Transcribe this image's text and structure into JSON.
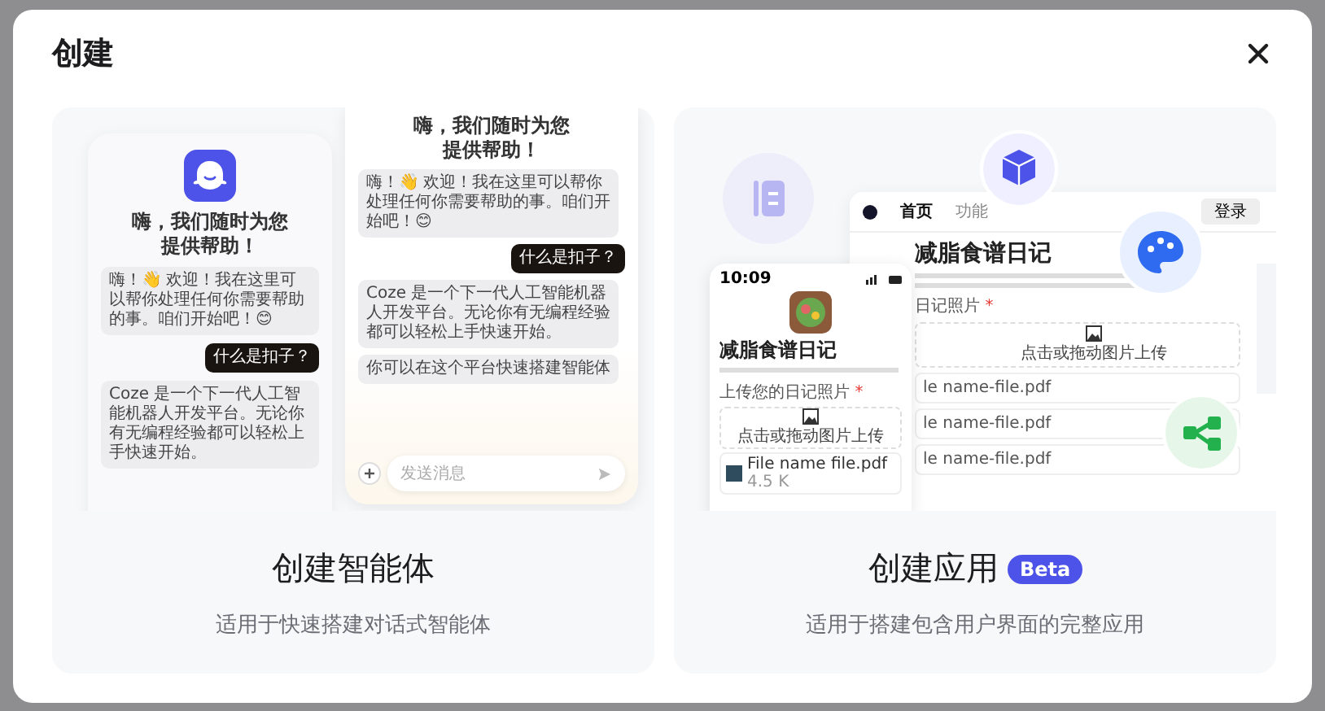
{
  "dialog": {
    "title": "创建"
  },
  "cards": [
    {
      "kind": "agent",
      "title": "创建智能体",
      "subtitle": "适用于快速搭建对话式智能体",
      "preview": {
        "left_phone": {
          "heading": "嗨，我们随时为您提供帮助！",
          "messages": [
            {
              "kind": "bot",
              "text": "嗨！👋 欢迎！我在这里可以帮你处理任何你需要帮助的事。咱们开始吧！😊"
            },
            {
              "kind": "user",
              "text": "什么是扣子？"
            },
            {
              "kind": "bot",
              "text": "Coze 是一个下一代人工智能机器人开发平台。无论你有无编程经验都可以轻松上手快速开始。"
            }
          ]
        },
        "right_phone": {
          "heading": "嗨，我们随时为您提供帮助！",
          "messages": [
            {
              "kind": "bot",
              "text": "嗨！👋 欢迎！我在这里可以帮你处理任何你需要帮助的事。咱们开始吧！😊"
            },
            {
              "kind": "user",
              "text": "什么是扣子？"
            },
            {
              "kind": "bot",
              "text": "Coze 是一个下一代人工智能机器人开发平台。无论你有无编程经验都可以轻松上手快速开始。"
            },
            {
              "kind": "bot",
              "text": "你可以在这个平台快速搭建智能体"
            }
          ],
          "input_placeholder": "发送消息"
        }
      }
    },
    {
      "kind": "app",
      "title": "创建应用",
      "badge": "Beta",
      "subtitle": "适用于搭建包含用户界面的完整应用",
      "preview": {
        "desktop": {
          "tabs": [
            {
              "label": "首页",
              "selected": true
            },
            {
              "label": "功能",
              "selected": false
            }
          ],
          "button": "登录",
          "title": "减脂食谱日记",
          "field_label": "日记照片",
          "required_mark": "*",
          "upload_hint": "点击或拖动图片上传",
          "files": [
            "le name-file.pdf",
            "le name-file.pdf",
            "le name-file.pdf"
          ]
        },
        "phone": {
          "time": "10:09",
          "title": "减脂食谱日记",
          "field_label": "上传您的日记照片",
          "required_mark": "*",
          "upload_hint": "点击或拖动图片上传",
          "file_name": "File name file.pdf",
          "file_size": "4.5 K"
        }
      }
    }
  ]
}
